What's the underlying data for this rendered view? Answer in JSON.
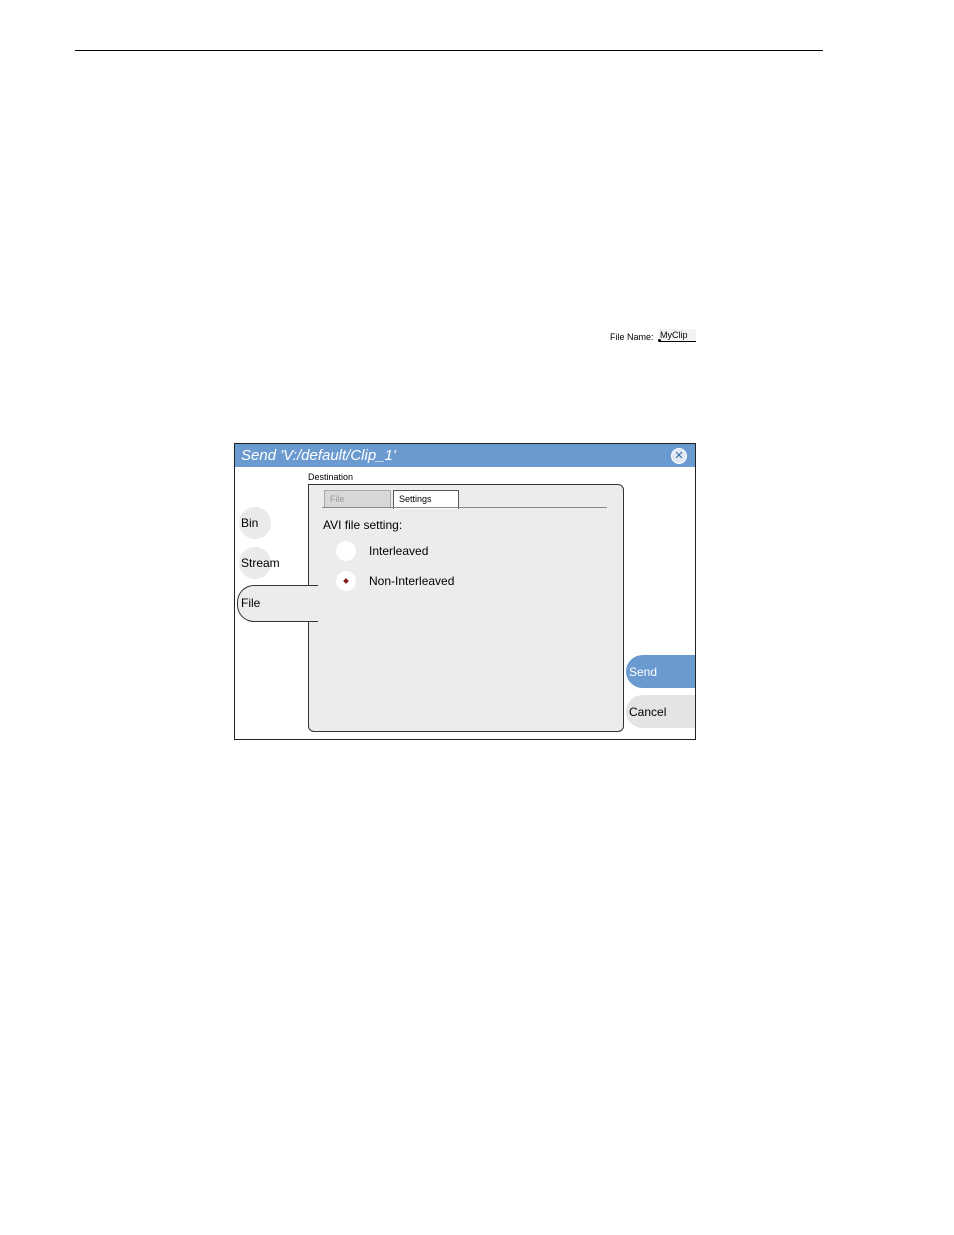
{
  "file_name_field": {
    "label": "File Name:",
    "value": "MyClip"
  },
  "dialog": {
    "title": "Send 'V:/default/Clip_1'",
    "close_icon": "close-icon",
    "destination_label": "Destination",
    "side_tabs": [
      "Bin",
      "Stream",
      "File"
    ],
    "selected_side_tab": "File",
    "sub_tabs": [
      "File",
      "Settings"
    ],
    "active_sub_tab": "Settings",
    "avi_label": "AVI file setting:",
    "radio_options": [
      "Interleaved",
      "Non-Interleaved"
    ],
    "selected_radio": "Non-Interleaved",
    "send_label": "Send",
    "cancel_label": "Cancel"
  },
  "colors": {
    "title_bar": "#6a9ad0",
    "send_button": "#6a9ad0",
    "radio_selected": "#8b1a1a"
  }
}
